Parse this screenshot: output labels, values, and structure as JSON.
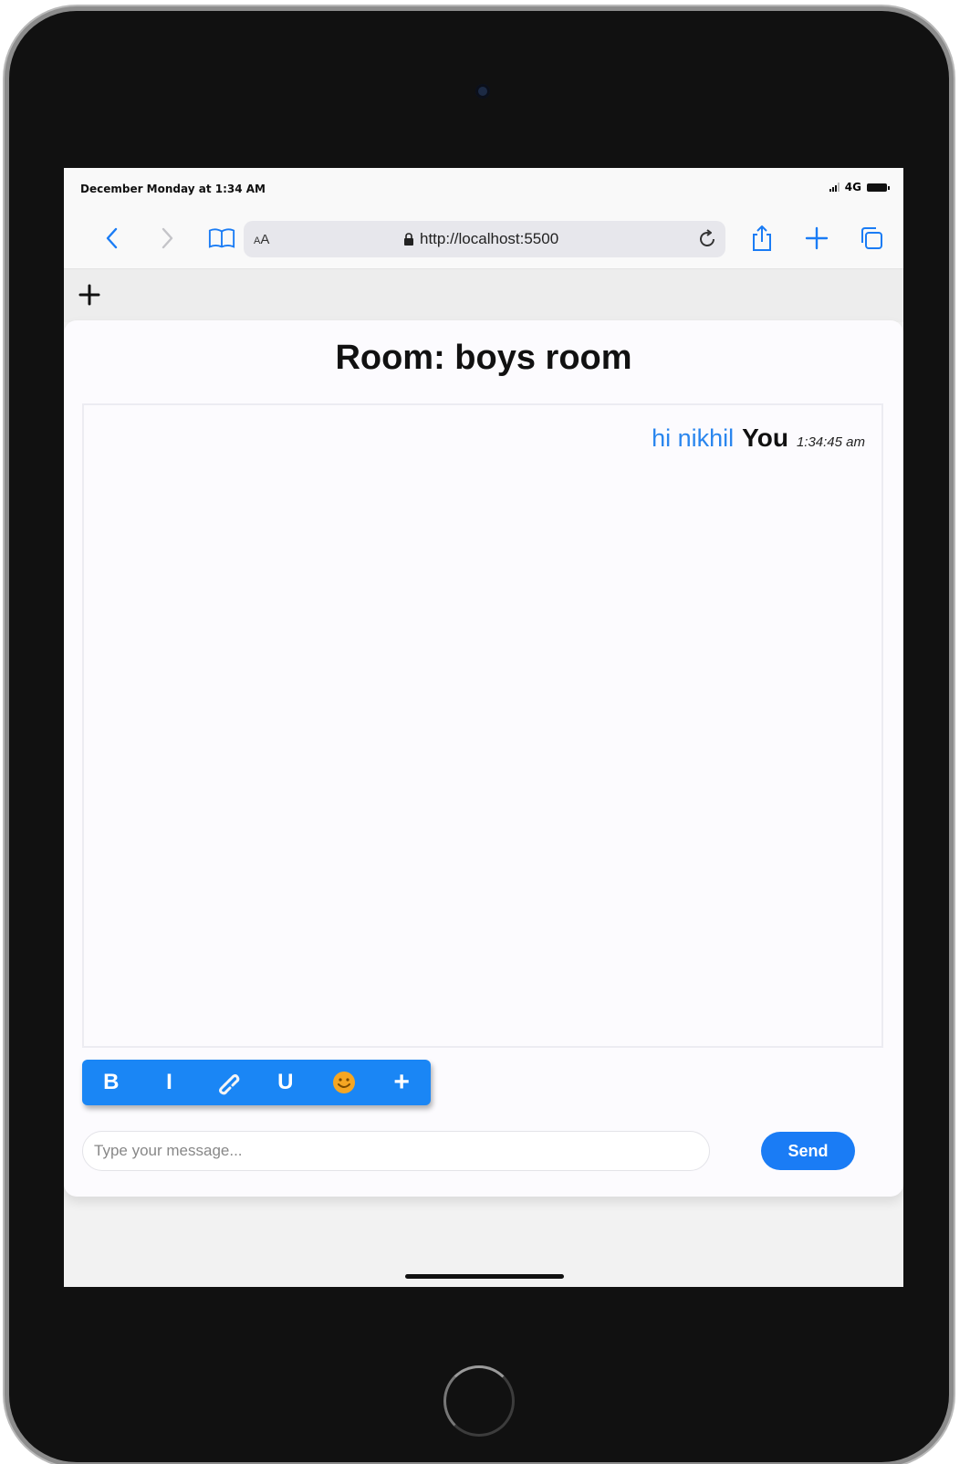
{
  "status_bar": {
    "time": "December Monday at 1:34 AM",
    "network": "4G"
  },
  "browser": {
    "text_size_label_small": "A",
    "text_size_label_large": "A",
    "url": "http://localhost:5500"
  },
  "chat": {
    "room_title": "Room: boys room",
    "messages": [
      {
        "text": "hi nikhil",
        "user": "You",
        "time": "1:34:45 am"
      }
    ]
  },
  "format_toolbar": {
    "bold_label": "B",
    "italic_label": "I",
    "link_icon": "link-icon",
    "underline_label": "U",
    "emoji_icon": "smiley-icon",
    "more_label": "+"
  },
  "composer": {
    "placeholder": "Type your message...",
    "send_label": "Send"
  },
  "colors": {
    "accent": "#1a7cf5",
    "message_text": "#2a86ee",
    "emoji": "#f5a623"
  }
}
